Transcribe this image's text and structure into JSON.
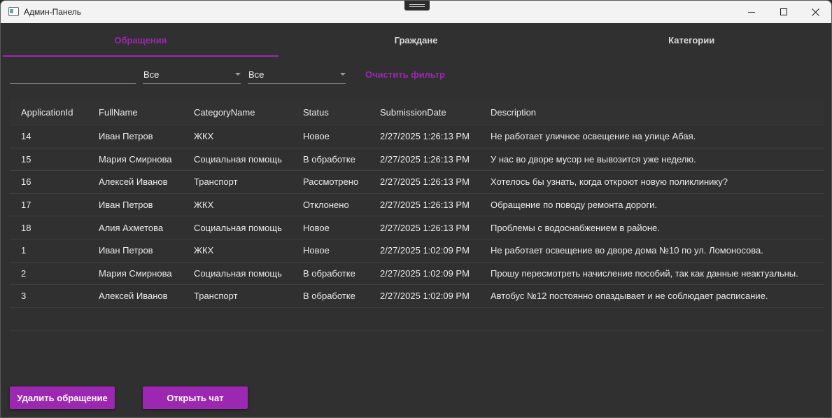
{
  "window": {
    "title": "Админ-Панель",
    "accent_color": "#9c27b0"
  },
  "tabs": [
    {
      "label": "Обращения",
      "active": true
    },
    {
      "label": "Граждане",
      "active": false
    },
    {
      "label": "Категории",
      "active": false
    }
  ],
  "filters": {
    "search_value": "",
    "category_selected": "Все",
    "status_selected": "Все",
    "clear_label": "Очистить фильтр"
  },
  "grid": {
    "columns": [
      "ApplicationId",
      "FullName",
      "CategoryName",
      "Status",
      "SubmissionDate",
      "Description"
    ],
    "rows": [
      [
        "14",
        "Иван Петров",
        "ЖКХ",
        "Новое",
        "2/27/2025 1:26:13 PM",
        "Не работает уличное освещение на улице Абая."
      ],
      [
        "15",
        "Мария Смирнова",
        "Социальная помощь",
        "В обработке",
        "2/27/2025 1:26:13 PM",
        "У нас во дворе мусор не вывозится уже неделю."
      ],
      [
        "16",
        "Алексей Иванов",
        "Транспорт",
        "Рассмотрено",
        "2/27/2025 1:26:13 PM",
        "Хотелось бы узнать, когда откроют новую поликлинику?"
      ],
      [
        "17",
        "Иван Петров",
        "ЖКХ",
        "Отклонено",
        "2/27/2025 1:26:13 PM",
        "Обращение по поводу ремонта дороги."
      ],
      [
        "18",
        "Алия Ахметова",
        "Социальная помощь",
        "Новое",
        "2/27/2025 1:26:13 PM",
        "Проблемы с водоснабжением в районе."
      ],
      [
        "1",
        "Иван Петров",
        "ЖКХ",
        "Новое",
        "2/27/2025 1:02:09 PM",
        "Не работает освещение во дворе дома №10 по ул. Ломоносова."
      ],
      [
        "2",
        "Мария Смирнова",
        "Социальная помощь",
        "В обработке",
        "2/27/2025 1:02:09 PM",
        "Прошу пересмотреть начисление пособий, так как данные неактуальны."
      ],
      [
        "3",
        "Алексей Иванов",
        "Транспорт",
        "В обработке",
        "2/27/2025 1:02:09 PM",
        "Автобус №12 постоянно опаздывает и не соблюдает расписание."
      ]
    ]
  },
  "actions": {
    "delete_label": "Удалить обращение",
    "chat_label": "Открыть чат"
  }
}
